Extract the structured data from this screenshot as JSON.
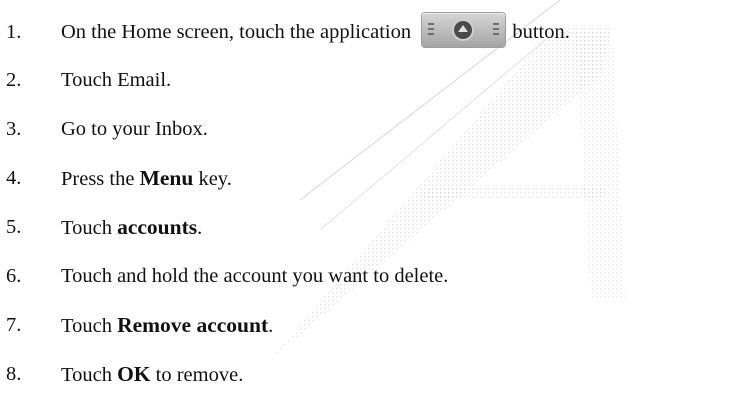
{
  "steps": [
    {
      "number": "1.",
      "before": "On the Home screen, touch the application ",
      "after": " button.",
      "icon": "application-launcher-icon"
    },
    {
      "number": "2.",
      "before": "Touch Email."
    },
    {
      "number": "3.",
      "before": "Go to your Inbox."
    },
    {
      "number": "4.",
      "before": "Press the ",
      "bold": "Menu",
      "after": " key."
    },
    {
      "number": "5.",
      "before": "Touch ",
      "bold": "accounts",
      "after": "."
    },
    {
      "number": "6.",
      "before": "Touch and hold the account you want to delete."
    },
    {
      "number": "7.",
      "before": "Touch ",
      "bold": "Remove account",
      "after": "."
    },
    {
      "number": "8.",
      "before": "Touch ",
      "bold": "OK",
      "after": " to remove."
    }
  ]
}
